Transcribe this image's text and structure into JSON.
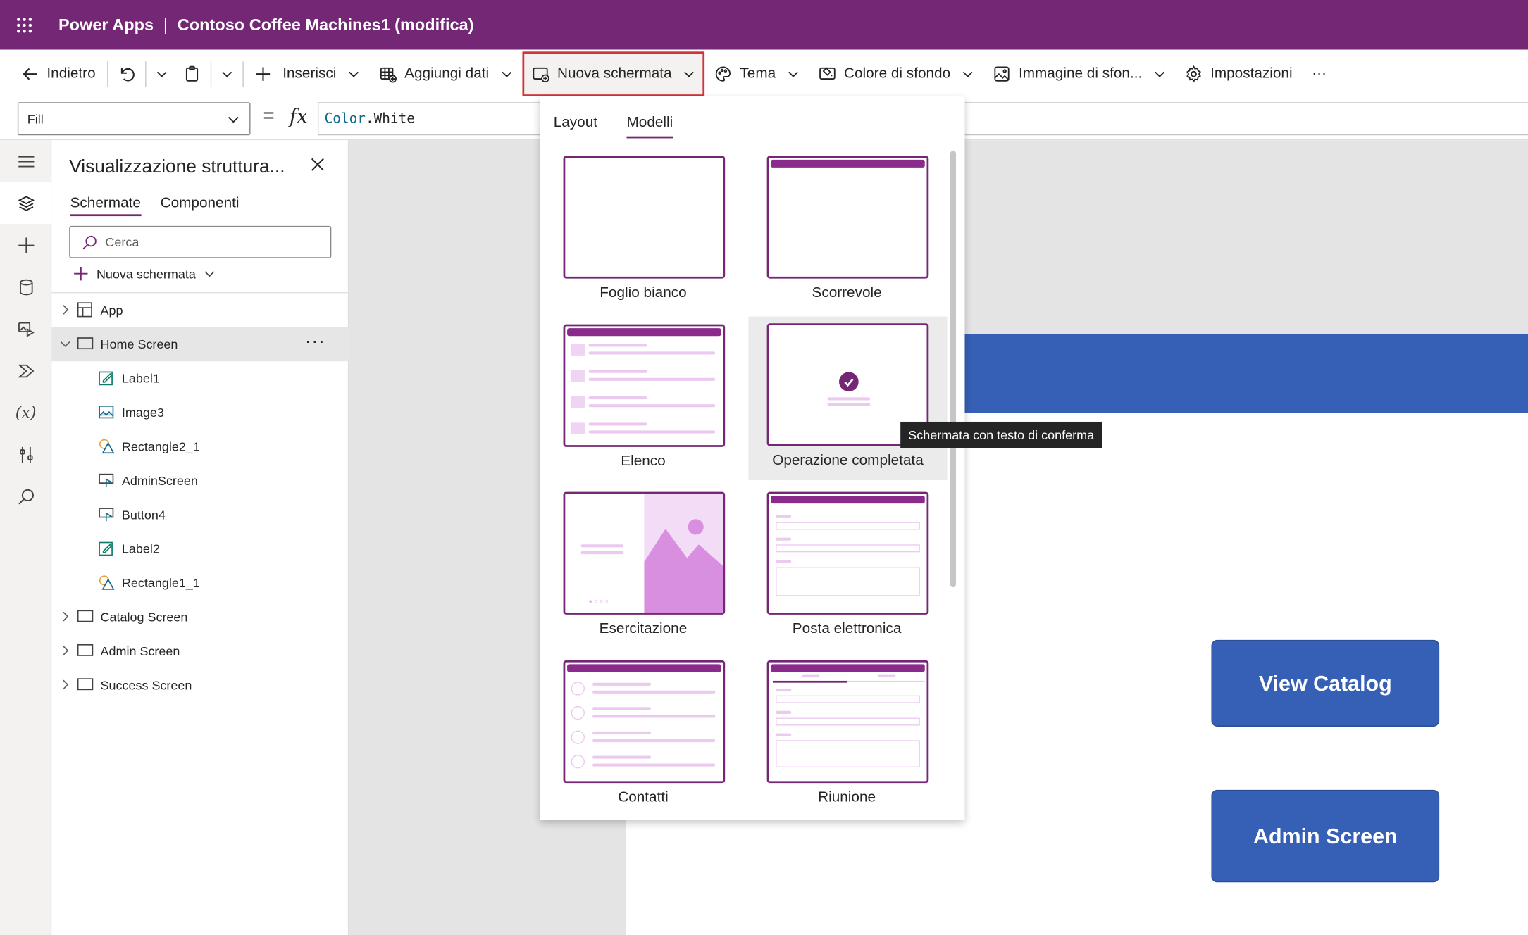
{
  "app": {
    "brand": "Power Apps",
    "separator": "|",
    "document": "Contoso Coffee Machines1 (modifica)"
  },
  "colors": {
    "brand": "#742774",
    "highlight_border": "#d13438",
    "screen_blue": "#3660b5"
  },
  "command_bar": {
    "back": "Indietro",
    "insert": "Inserisci",
    "add_data": "Aggiungi dati",
    "new_screen": "Nuova schermata",
    "theme": "Tema",
    "background_color": "Colore di sfondo",
    "background_image": "Immagine di sfon...",
    "settings": "Impostazioni",
    "more": "···"
  },
  "formula_bar": {
    "property": "Fill",
    "equals": "=",
    "fx": "fx",
    "formula_object": "Color",
    "formula_member": ".White"
  },
  "tree_panel": {
    "title": "Visualizzazione struttura...",
    "tabs": [
      "Schermate",
      "Componenti"
    ],
    "search_placeholder": "Cerca",
    "new_screen": "Nuova schermata",
    "more": "···",
    "items": [
      {
        "label": "App",
        "icon": "app-icon",
        "level": 0,
        "expander": "collapsed"
      },
      {
        "label": "Home Screen",
        "icon": "screen-icon",
        "level": 0,
        "expander": "expanded",
        "selected": true
      },
      {
        "label": "Label1",
        "icon": "label-icon",
        "level": 1
      },
      {
        "label": "Image3",
        "icon": "image-icon",
        "level": 1
      },
      {
        "label": "Rectangle2_1",
        "icon": "shape-icon",
        "level": 1
      },
      {
        "label": "AdminScreen",
        "icon": "button-icon",
        "level": 1
      },
      {
        "label": "Button4",
        "icon": "button-icon",
        "level": 1
      },
      {
        "label": "Label2",
        "icon": "label-icon",
        "level": 1
      },
      {
        "label": "Rectangle1_1",
        "icon": "shape-icon",
        "level": 1
      },
      {
        "label": "Catalog Screen",
        "icon": "screen-icon",
        "level": 0,
        "expander": "collapsed"
      },
      {
        "label": "Admin Screen",
        "icon": "screen-icon",
        "level": 0,
        "expander": "collapsed"
      },
      {
        "label": "Success Screen",
        "icon": "screen-icon",
        "level": 0,
        "expander": "collapsed"
      }
    ]
  },
  "new_screen_menu": {
    "tabs": [
      "Layout",
      "Modelli"
    ],
    "active_tab": "Modelli",
    "templates": [
      {
        "label": "Foglio bianco",
        "kind": "blank"
      },
      {
        "label": "Scorrevole",
        "kind": "scrollable"
      },
      {
        "label": "Elenco",
        "kind": "list"
      },
      {
        "label": "Operazione completata",
        "kind": "success",
        "hovered": true
      },
      {
        "label": "Esercitazione",
        "kind": "tutorial"
      },
      {
        "label": "Posta elettronica",
        "kind": "email"
      },
      {
        "label": "Contatti",
        "kind": "people"
      },
      {
        "label": "Riunione",
        "kind": "meeting"
      }
    ],
    "tooltip": "Schermata con testo di conferma"
  },
  "canvas": {
    "buttons": [
      "View Catalog",
      "Admin Screen"
    ]
  }
}
